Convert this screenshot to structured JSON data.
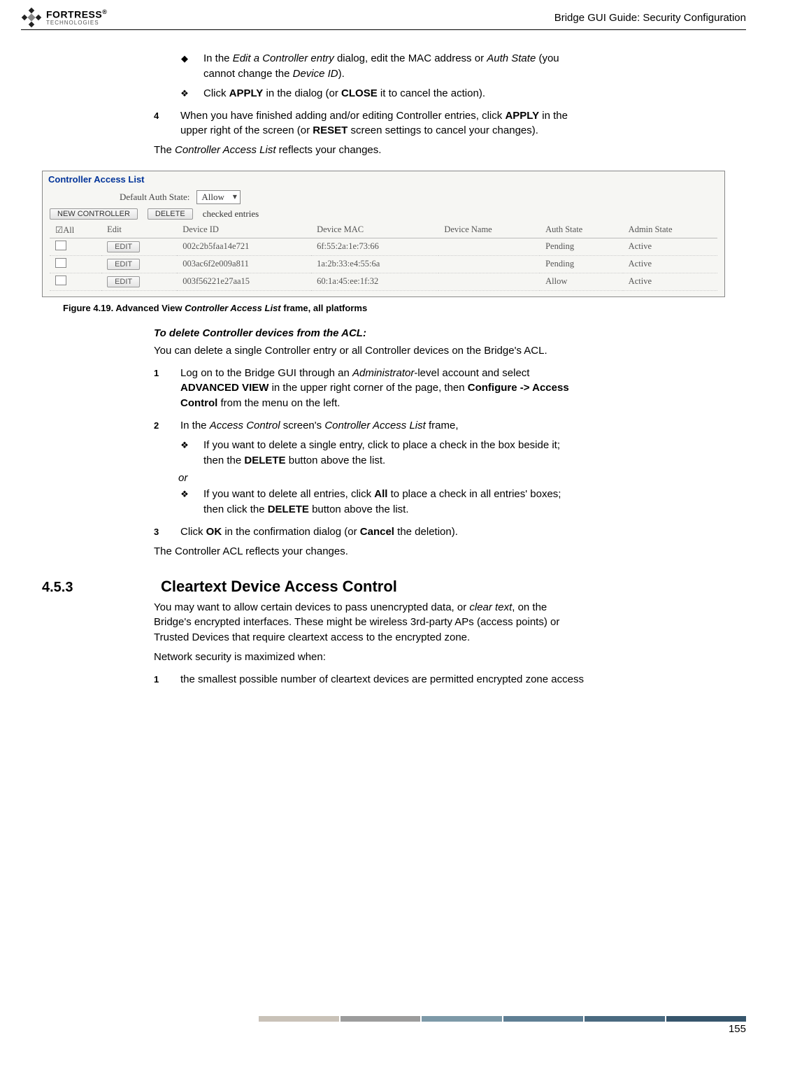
{
  "header": {
    "brand_top": "FORTRESS",
    "brand_sub": "TECHNOLOGIES",
    "title": "Bridge GUI Guide: Security Configuration"
  },
  "intro_bullets": {
    "b1_pre": "In the ",
    "b1_em1": "Edit a Controller entry",
    "b1_mid": " dialog, edit the MAC address or ",
    "b1_em2": "Auth State",
    "b1_mid2": " (you cannot change the ",
    "b1_em3": "Device ID",
    "b1_end": ").",
    "b2_pre": "Click ",
    "b2_sc1": "APPLY",
    "b2_mid": " in the dialog (or ",
    "b2_sc2": "CLOSE",
    "b2_end": " it to cancel the action)."
  },
  "step4": {
    "num": "4",
    "pre": "When you have finished adding and/or editing Controller entries, click ",
    "sc1": "APPLY",
    "mid": " in the upper right of the screen (or ",
    "sc2": "RESET",
    "end": " screen settings to cancel your changes)."
  },
  "post4_pre": "The ",
  "post4_em": "Controller Access List",
  "post4_end": " reflects your changes.",
  "screenshot": {
    "legend": "Controller Access List",
    "default_label": "Default Auth State:",
    "default_value": "Allow",
    "btn_new": "NEW CONTROLLER",
    "btn_delete": "DELETE",
    "checked_entries": "checked entries",
    "cols": {
      "all": "☑All",
      "edit": "Edit",
      "devid": "Device ID",
      "mac": "Device MAC",
      "name": "Device Name",
      "auth": "Auth State",
      "admin": "Admin State"
    },
    "rows": [
      {
        "id": "002c2b5faa14e721",
        "mac": "6f:55:2a:1e:73:66",
        "auth": "Pending",
        "admin": "Active"
      },
      {
        "id": "003ac6f2e009a811",
        "mac": "1a:2b:33:e4:55:6a",
        "auth": "Pending",
        "admin": "Active"
      },
      {
        "id": "003f56221e27aa15",
        "mac": "60:1a:45:ee:1f:32",
        "auth": "Allow",
        "admin": "Active"
      }
    ],
    "edit_btn": "EDIT"
  },
  "figure": {
    "pre": "Figure 4.19. Advanced View ",
    "em": "Controller Access List",
    "post": " frame, all platforms"
  },
  "task2": {
    "heading": "To delete Controller devices from the ACL:",
    "intro": "You can delete a single Controller entry or all Controller devices on the Bridge's ACL.",
    "s1": {
      "num": "1",
      "pre": "Log on to the Bridge GUI through an ",
      "em1": "Administrator",
      "mid1": "-level account and select ",
      "sc1": "ADVANCED VIEW",
      "mid2": " in the upper right corner of the page, then ",
      "b1": "Configure -> Access Control",
      "end": " from the menu on the left."
    },
    "s2": {
      "num": "2",
      "pre": "In the ",
      "em1": "Access Control",
      "mid": " screen's ",
      "em2": "Controller Access List",
      "end": " frame,"
    },
    "s2b1": {
      "pre": "If you want to delete a single entry, click to place a check in the box beside it; then the ",
      "sc": "DELETE",
      "end": " button above the list."
    },
    "or": "or",
    "s2b2": {
      "pre": "If you want to delete all entries, click ",
      "b": "All",
      "mid": " to place a check in all entries' boxes; then click the ",
      "sc": "DELETE",
      "end": " button above the list."
    },
    "s3": {
      "num": "3",
      "pre": "Click ",
      "sc": "OK",
      "mid": " in the confirmation dialog (or ",
      "b": "Cancel",
      "end": " the deletion)."
    },
    "outro": "The Controller ACL reflects your changes."
  },
  "section": {
    "num": "4.5.3",
    "title": "Cleartext Device Access Control",
    "p1_pre": "You may want to allow certain devices to pass unencrypted data, or ",
    "p1_em": "clear text",
    "p1_end": ", on the Bridge's encrypted interfaces. These might be wireless 3rd-party APs (access points) or Trusted Devices that require cleartext access to the encrypted zone.",
    "p2": "Network security is maximized when:",
    "li1_num": "1",
    "li1": "the smallest possible number of cleartext devices are permitted encrypted zone access"
  },
  "page_number": "155"
}
